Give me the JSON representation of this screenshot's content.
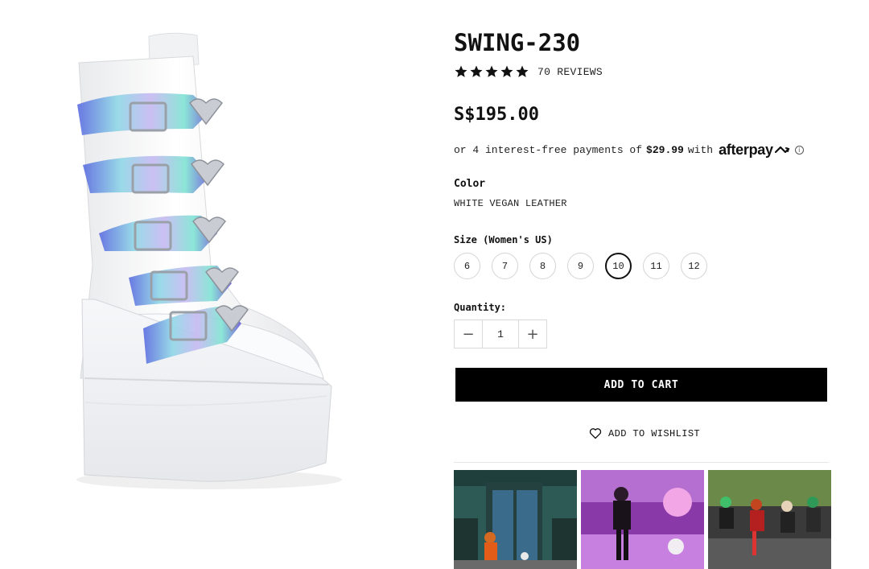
{
  "product": {
    "title": "SWING-230",
    "rating_stars": 5,
    "reviews_label": "70 REVIEWS",
    "price": "S$195.00",
    "afterpay": {
      "prefix": "or 4 interest-free payments of",
      "amount": "$29.99",
      "suffix": "with",
      "brand": "afterpay",
      "info_icon": "info-icon"
    },
    "color_label": "Color",
    "color_value": "WHITE VEGAN LEATHER",
    "size_label": "Size (Women's US)",
    "sizes": [
      "6",
      "7",
      "8",
      "9",
      "10",
      "11",
      "12"
    ],
    "selected_size": "10",
    "quantity_label": "Quantity:",
    "quantity": "1",
    "minus_symbol": "−",
    "plus_symbol": "+",
    "add_to_cart": "ADD TO CART",
    "add_to_wishlist": "ADD TO WISHLIST"
  },
  "icons": {
    "star": "star-icon",
    "heart": "heart-icon",
    "afterpay_logo": "afterpay-arrows-icon"
  },
  "colors": {
    "accent": "#000000",
    "button_text": "#ffffff",
    "border": "#d4d4d4"
  }
}
